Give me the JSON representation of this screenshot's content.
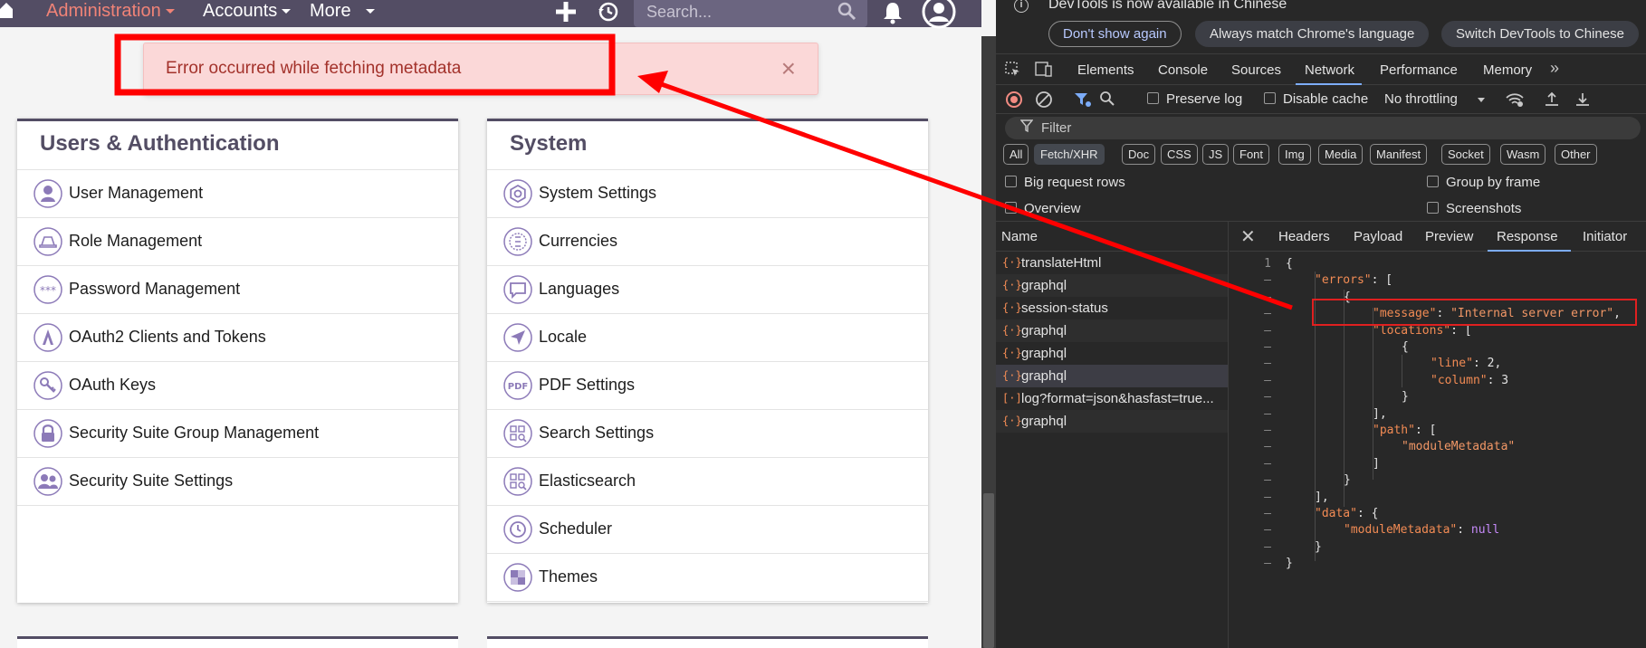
{
  "nav": {
    "items": [
      {
        "label": "Administration"
      },
      {
        "label": "Accounts"
      },
      {
        "label": "More"
      }
    ],
    "search_placeholder": "Search..."
  },
  "alert": {
    "message": "Error occurred while fetching metadata",
    "close_glyph": "×"
  },
  "panels": {
    "users": {
      "title": "Users & Authentication",
      "items": [
        {
          "label": "User Management",
          "icon": "user-icon"
        },
        {
          "label": "Role Management",
          "icon": "role-icon"
        },
        {
          "label": "Password Management",
          "icon": "password-icon"
        },
        {
          "label": "OAuth2 Clients and Tokens",
          "icon": "oauth2-icon"
        },
        {
          "label": "OAuth Keys",
          "icon": "key-icon"
        },
        {
          "label": "Security Suite Group Management",
          "icon": "lock-icon"
        },
        {
          "label": "Security Suite Settings",
          "icon": "group-icon"
        }
      ]
    },
    "system": {
      "title": "System",
      "items": [
        {
          "label": "System Settings",
          "icon": "gear-icon"
        },
        {
          "label": "Currencies",
          "icon": "currency-icon"
        },
        {
          "label": "Languages",
          "icon": "speech-bubble-icon"
        },
        {
          "label": "Locale",
          "icon": "location-arrow-icon"
        },
        {
          "label": "PDF Settings",
          "icon": "pdf-icon",
          "badge": "PDF"
        },
        {
          "label": "Search Settings",
          "icon": "search-settings-icon"
        },
        {
          "label": "Elasticsearch",
          "icon": "elasticsearch-icon"
        },
        {
          "label": "Scheduler",
          "icon": "clock-icon"
        },
        {
          "label": "Themes",
          "icon": "themes-icon"
        }
      ]
    }
  },
  "devtools": {
    "info_text": "DevTools is now available in Chinese",
    "buttons": {
      "dont_show": "Don't show again",
      "match": "Always match Chrome's language",
      "switch": "Switch DevTools to Chinese"
    },
    "tabs": [
      "Elements",
      "Console",
      "Sources",
      "Network",
      "Performance",
      "Memory"
    ],
    "active_tab": "Network",
    "toolbar": {
      "preserve_log": "Preserve log",
      "disable_cache": "Disable cache",
      "throttling": "No throttling"
    },
    "filter_placeholder": "Filter",
    "type_filters": [
      "All",
      "Fetch/XHR",
      "Doc",
      "CSS",
      "JS",
      "Font",
      "Img",
      "Media",
      "Manifest",
      "Socket",
      "Wasm",
      "Other"
    ],
    "active_type": "Fetch/XHR",
    "options": {
      "big_rows": "Big request rows",
      "overview": "Overview",
      "group_by_frame": "Group by frame",
      "screenshots": "Screenshots"
    },
    "name_header": "Name",
    "requests": [
      {
        "name": "translateHtml",
        "icon": "{·}"
      },
      {
        "name": "graphql",
        "icon": "{·}"
      },
      {
        "name": "session-status",
        "icon": "{·}"
      },
      {
        "name": "graphql",
        "icon": "{·}"
      },
      {
        "name": "graphql",
        "icon": "{·}"
      },
      {
        "name": "graphql",
        "icon": "{·}"
      },
      {
        "name": "log?format=json&hasfast=true...",
        "icon": "[·]"
      },
      {
        "name": "graphql",
        "icon": "{·}"
      }
    ],
    "detail_tabs": [
      "Headers",
      "Payload",
      "Preview",
      "Response",
      "Initiator"
    ],
    "active_detail_tab": "Response",
    "response_lines": [
      {
        "ln": "1",
        "text": "{"
      },
      {
        "ln": "–",
        "key": "\"errors\"",
        "rest": ": ["
      },
      {
        "ln": "–",
        "text": "{"
      },
      {
        "ln": "–",
        "key": "\"message\"",
        "rest": ": ",
        "str": "\"Internal server error\"",
        "tail": ","
      },
      {
        "ln": "–",
        "key": "\"locations\"",
        "rest": ": ["
      },
      {
        "ln": "–",
        "text": "{"
      },
      {
        "ln": "–",
        "key": "\"line\"",
        "rest": ": 2,"
      },
      {
        "ln": "–",
        "key": "\"column\"",
        "rest": ": 3"
      },
      {
        "ln": "–",
        "text": "}"
      },
      {
        "ln": "–",
        "text": "],"
      },
      {
        "ln": "–",
        "key": "\"path\"",
        "rest": ": ["
      },
      {
        "ln": "–",
        "str": "\"moduleMetadata\""
      },
      {
        "ln": "–",
        "text": "]"
      },
      {
        "ln": "–",
        "text": "}"
      },
      {
        "ln": "–",
        "text": "],"
      },
      {
        "ln": "–",
        "key": "\"data\"",
        "rest": ": {"
      },
      {
        "ln": "–",
        "key": "\"moduleMetadata\"",
        "rest": ": ",
        "kw": "null"
      },
      {
        "ln": "–",
        "text": "}"
      },
      {
        "ln": "–",
        "text": "}"
      }
    ]
  },
  "colors": {
    "nav_bg": "#534d64",
    "nav_active": "#f08377",
    "alert_bg": "#fbd8d8",
    "annotation_red": "#ff0000",
    "devtools_bg": "#282828",
    "icon_purple": "#8c7ab8"
  }
}
